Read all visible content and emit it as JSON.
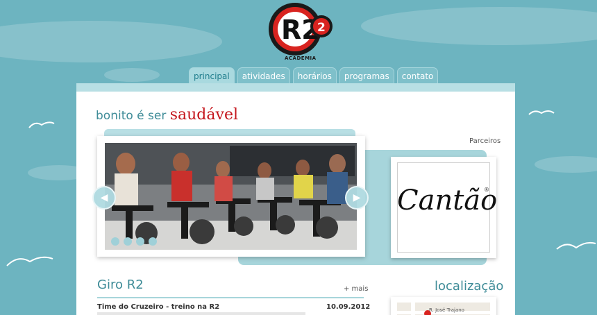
{
  "header": {
    "logo_text": "R2",
    "logo_badge": "2",
    "logo_subtitle": "ACADEMIA"
  },
  "nav": {
    "tabs": [
      {
        "label": "principal",
        "active": true
      },
      {
        "label": "atividades",
        "active": false
      },
      {
        "label": "horários",
        "active": false
      },
      {
        "label": "programas",
        "active": false
      },
      {
        "label": "contato",
        "active": false
      }
    ]
  },
  "hero": {
    "headline_prefix": "bonito é ser",
    "headline_strong": "saudável",
    "slider_dots": 4,
    "slider_prev_icon": "arrow-left-icon",
    "slider_next_icon": "arrow-right-icon"
  },
  "partners": {
    "label": "Parceiros",
    "partner_name": "Cantão",
    "registered_mark": "®"
  },
  "giro": {
    "title": "Giro R2",
    "more_link": "+ mais",
    "news": [
      {
        "title": "Time do Cruzeiro - treino na R2",
        "date": "10.09.2012"
      }
    ]
  },
  "location": {
    "title": "localização",
    "street_label": "R. José Trajano"
  },
  "colors": {
    "sky": "#6db4c0",
    "accent_teal": "#3f8c98",
    "accent_red": "#c4151c",
    "tab_bg": "#7fc0ca",
    "panel_teal": "#a7d5db"
  }
}
